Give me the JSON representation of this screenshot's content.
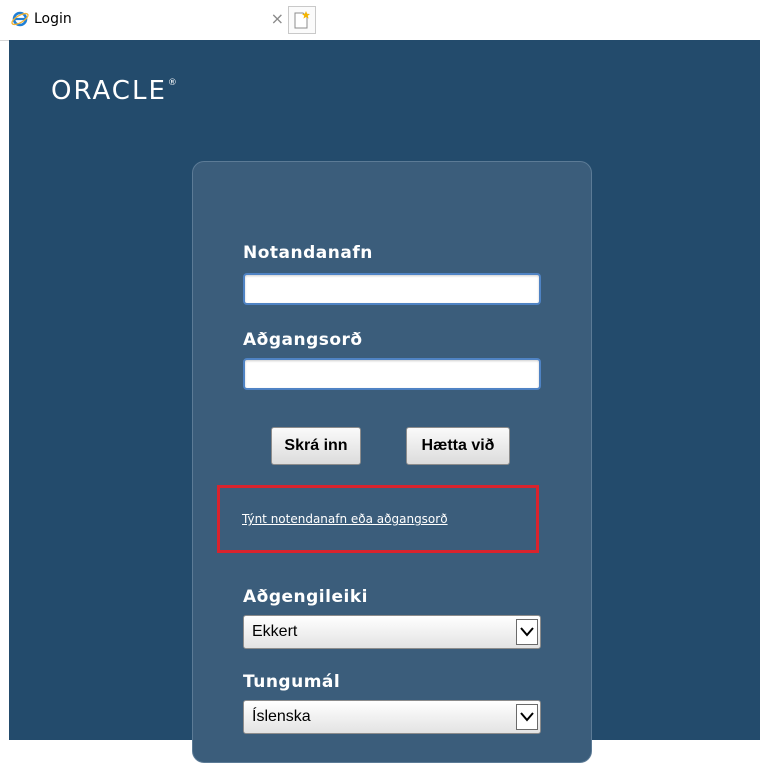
{
  "browser": {
    "tab_title": "Login",
    "close_symbol": "×"
  },
  "logo": {
    "text": "ORACLE",
    "mark": "®"
  },
  "form": {
    "username_label": "Notandanafn",
    "username_value": "",
    "password_label": "Aðgangsorð",
    "password_value": "",
    "login_button": "Skrá inn",
    "cancel_button": "Hætta við",
    "forgot_link": "Týnt notendanafn eða aðgangsorð",
    "accessibility_label": "Aðgengileiki",
    "accessibility_value": "Ekkert",
    "language_label": "Tungumál",
    "language_value": "Íslenska"
  },
  "colors": {
    "page_background": "#234b6c",
    "card_background": "#3b5d7b",
    "highlight": "#d9232d"
  }
}
